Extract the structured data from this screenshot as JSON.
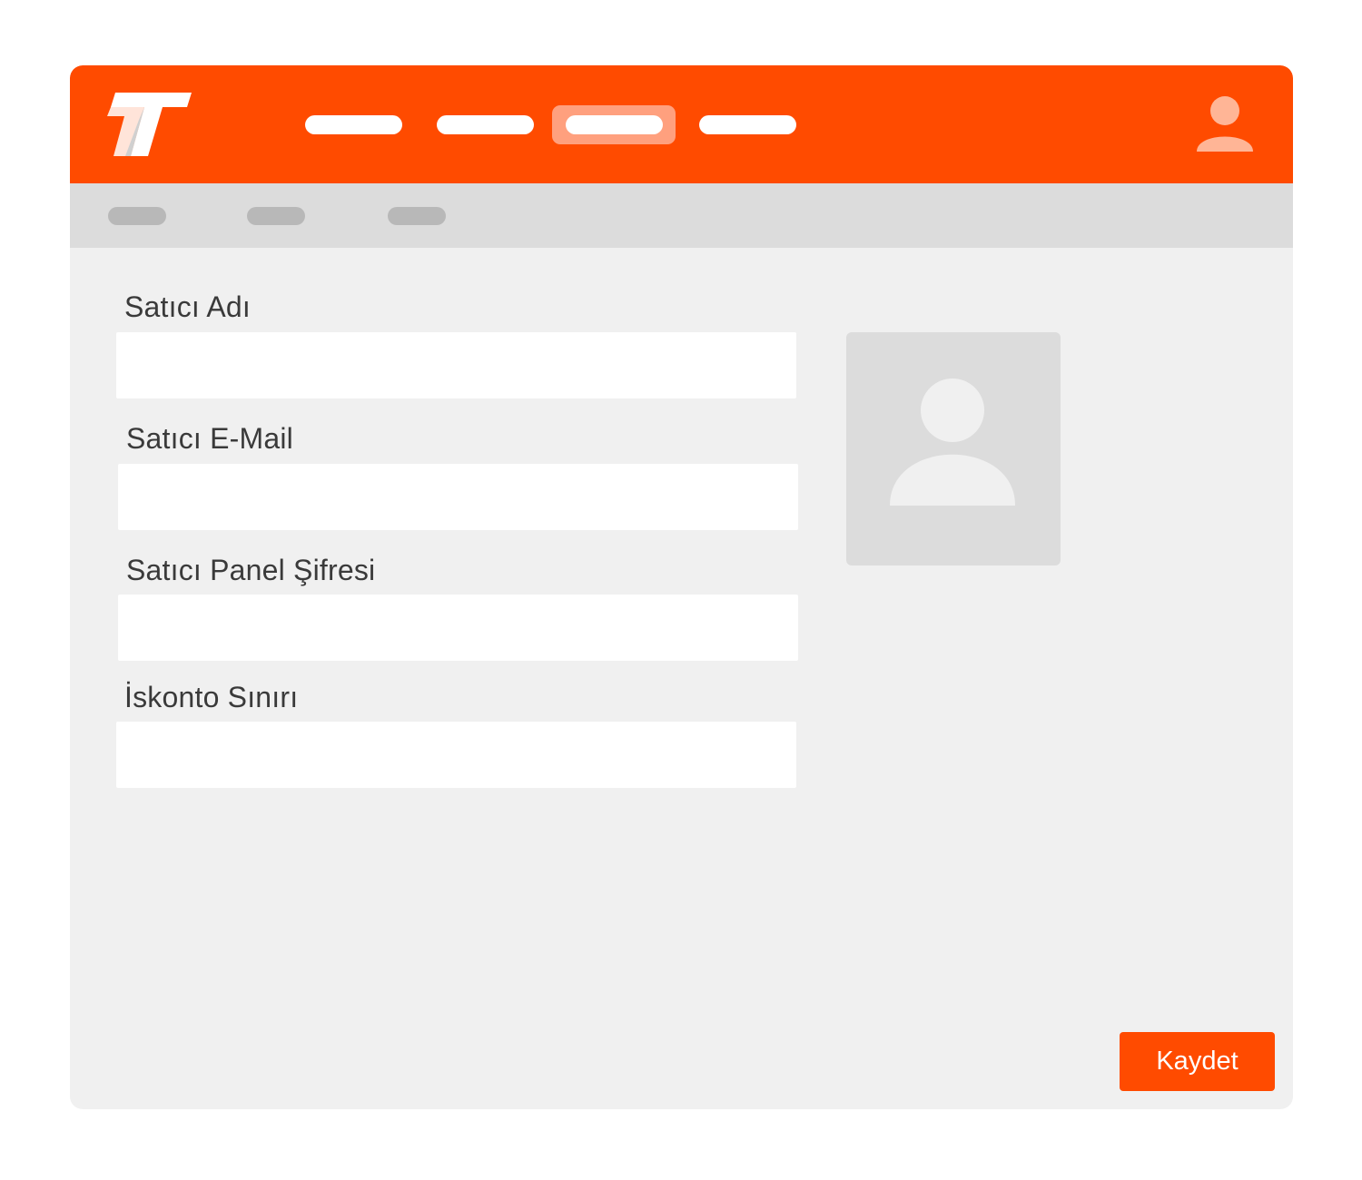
{
  "colors": {
    "brand": "#ff4b00",
    "nav_active": "#ffa07e",
    "subbar": "#dcdcdc",
    "content_bg": "#f0f0f0"
  },
  "header": {
    "logo_icon": "tt-logo-icon",
    "user_icon": "user-icon",
    "nav_items": [
      {
        "name": "nav-item-1",
        "active": false
      },
      {
        "name": "nav-item-2",
        "active": false
      },
      {
        "name": "nav-item-3",
        "active": true
      },
      {
        "name": "nav-item-4",
        "active": false
      }
    ]
  },
  "form": {
    "fields": [
      {
        "label": "Satıcı Adı",
        "value": ""
      },
      {
        "label": "Satıcı E-Mail",
        "value": ""
      },
      {
        "label": "Satıcı Panel Şifresi",
        "value": ""
      },
      {
        "label": "İskonto Sınırı",
        "value": ""
      }
    ],
    "avatar_icon": "avatar-placeholder-icon",
    "save_label": "Kaydet"
  }
}
